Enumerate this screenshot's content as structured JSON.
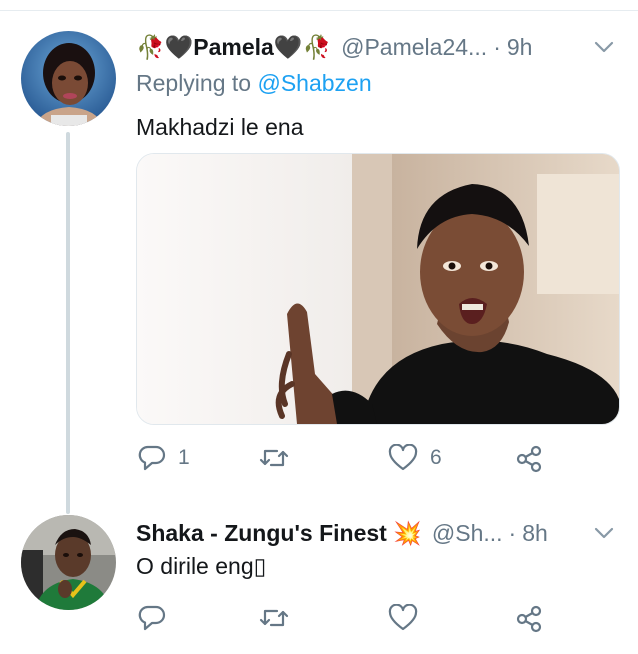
{
  "tweets": [
    {
      "display_name": "🥀🖤Pamela🖤🥀",
      "handle": "@Pamela24...",
      "time": "9h",
      "replying_prefix": "Replying to",
      "replying_handle": "@Shabzen",
      "text": "Makhadzi le ena",
      "reply_count": "1",
      "retweet_count": "",
      "like_count": "6"
    },
    {
      "display_name": "Shaka - Zungu's Finest 💥",
      "handle": "@Sh...",
      "time": "8h",
      "text": "O dirile eng▯",
      "reply_count": "",
      "retweet_count": "",
      "like_count": ""
    }
  ],
  "icons": {
    "reply": "reply-icon",
    "retweet": "retweet-icon",
    "like": "heart-icon",
    "share": "share-icon",
    "more": "chevron-down-icon"
  },
  "colors": {
    "text": "#14171a",
    "muted": "#657786",
    "link": "#1da1f2",
    "thread_line": "#cfd9de"
  }
}
